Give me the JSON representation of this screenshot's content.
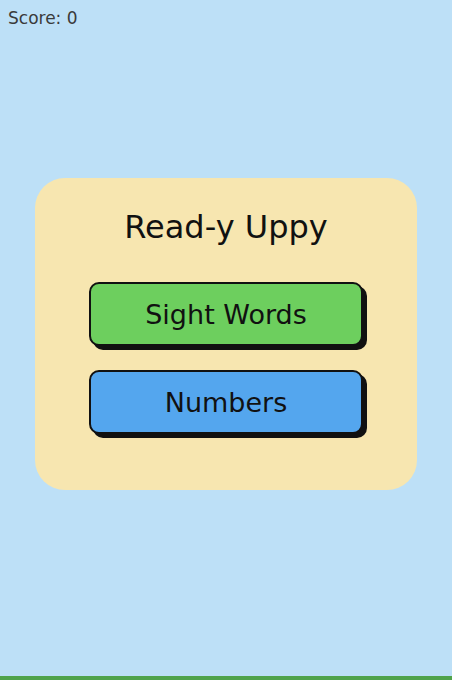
{
  "score": {
    "text": "Score: 0"
  },
  "menu": {
    "title": "Read-y Uppy",
    "buttons": [
      {
        "label": "Sight Words",
        "color": "#6dcf5e"
      },
      {
        "label": "Numbers",
        "color": "#54a6ee"
      }
    ]
  }
}
